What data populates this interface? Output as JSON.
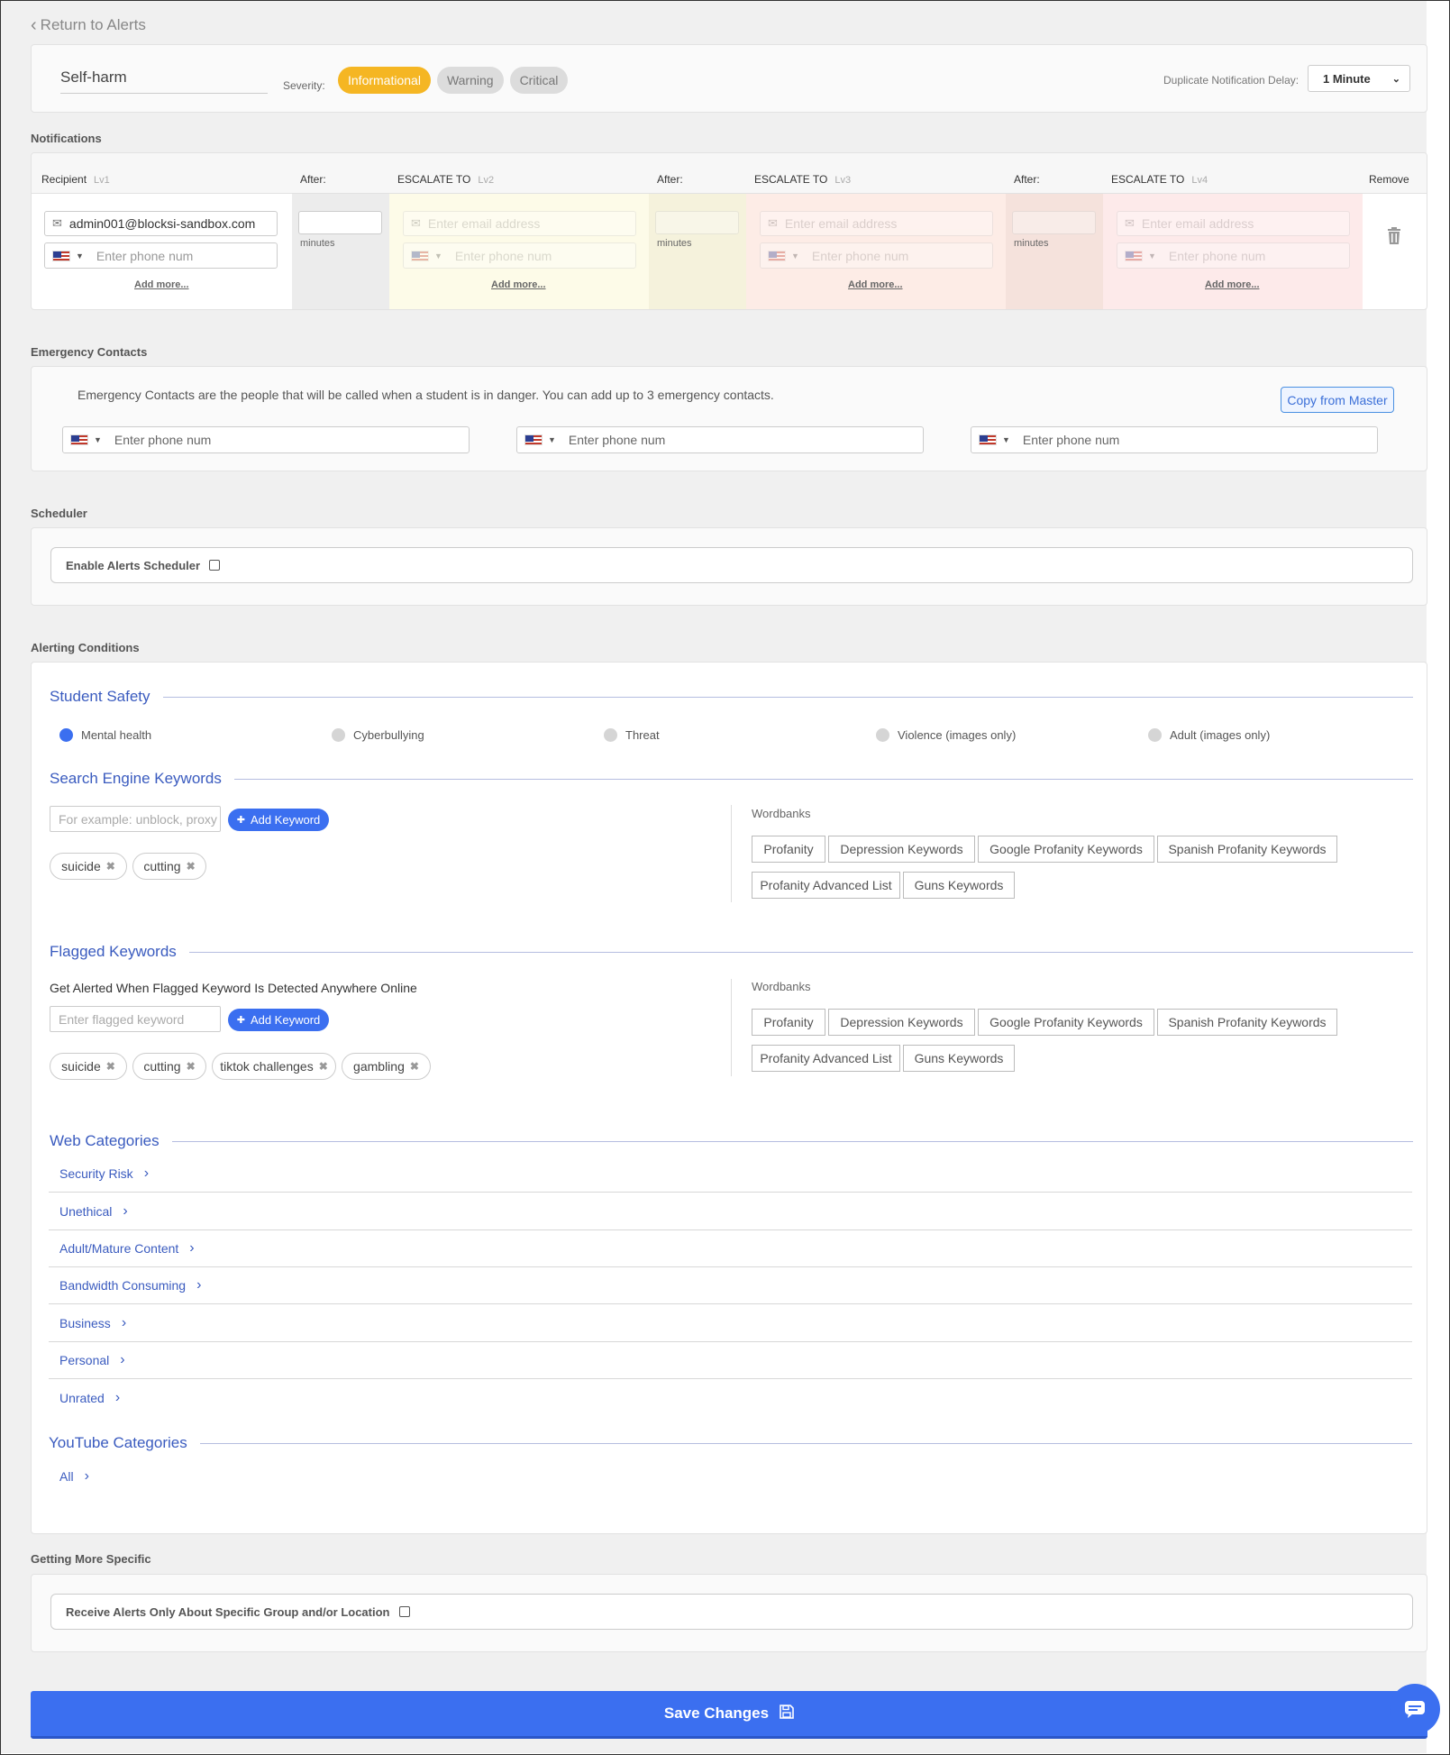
{
  "nav": {
    "return_label": "Return to Alerts"
  },
  "header": {
    "alert_name": "Self-harm",
    "severity_label": "Severity:",
    "severity_options": [
      "Informational",
      "Warning",
      "Critical"
    ],
    "severity_selected": "Informational",
    "dup_delay_label": "Duplicate Notification Delay:",
    "dup_delay_value": "1 Minute"
  },
  "colors": {
    "accent": "#3b6ff0",
    "informational": "#f5b623",
    "lv2_bg": "#fdfbe8",
    "lv3_bg": "#fdece6",
    "lv4_bg": "#fdeaea"
  },
  "notifications": {
    "section_title": "Notifications",
    "recipient_label": "Recipient",
    "lv1": "Lv1",
    "after_label": "After:",
    "escalate_label": "ESCALATE TO",
    "lv2": "Lv2",
    "lv3": "Lv3",
    "lv4": "Lv4",
    "remove_label": "Remove",
    "recipient_email": "admin001@blocksi-sandbox.com",
    "email_placeholder": "Enter email address",
    "phone_placeholder": "Enter phone num",
    "minutes_label": "minutes",
    "add_more": "Add more..."
  },
  "emergency": {
    "section_title": "Emergency Contacts",
    "description": "Emergency Contacts are the people that will be called when a student is in danger. You can add up to 3 emergency contacts.",
    "copy_button": "Copy from Master",
    "phone_placeholder": "Enter phone num"
  },
  "scheduler": {
    "section_title": "Scheduler",
    "enable_label": "Enable Alerts Scheduler"
  },
  "alerting": {
    "section_title": "Alerting Conditions",
    "student_safety": {
      "title": "Student Safety",
      "options": [
        "Mental health",
        "Cyberbullying",
        "Threat",
        "Violence (images only)",
        "Adult (images only)"
      ],
      "selected": "Mental health"
    },
    "search_keywords": {
      "title": "Search Engine Keywords",
      "placeholder": "For example: unblock, proxy",
      "add_label": "Add Keyword",
      "tags": [
        "suicide",
        "cutting"
      ]
    },
    "flagged_keywords": {
      "title": "Flagged Keywords",
      "description": "Get Alerted When Flagged Keyword Is Detected Anywhere Online",
      "placeholder": "Enter flagged keyword",
      "add_label": "Add Keyword",
      "tags": [
        "suicide",
        "cutting",
        "tiktok challenges",
        "gambling"
      ]
    },
    "wordbanks": {
      "label": "Wordbanks",
      "items": [
        "Profanity",
        "Depression Keywords",
        "Google Profanity Keywords",
        "Spanish Profanity Keywords",
        "Profanity Advanced List",
        "Guns Keywords"
      ]
    },
    "web_categories": {
      "title": "Web Categories",
      "items": [
        "Security Risk",
        "Unethical",
        "Adult/Mature Content",
        "Bandwidth Consuming",
        "Business",
        "Personal",
        "Unrated"
      ]
    },
    "youtube_categories": {
      "title": "YouTube Categories",
      "items": [
        "All"
      ]
    }
  },
  "specific": {
    "section_title": "Getting More Specific",
    "checkbox_label": "Receive Alerts Only About Specific Group and/or Location"
  },
  "footer": {
    "save_label": "Save Changes"
  }
}
